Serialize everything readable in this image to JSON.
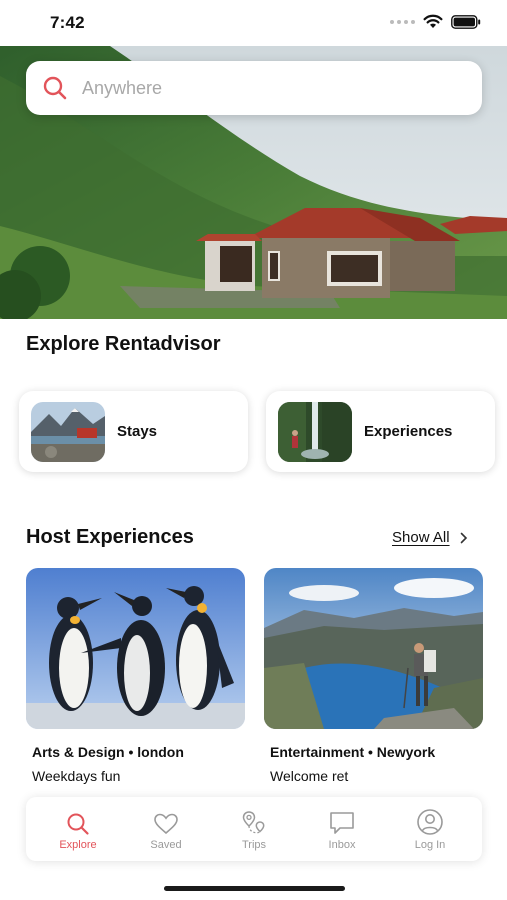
{
  "status_bar": {
    "time": "7:42"
  },
  "search": {
    "placeholder": "Anywhere"
  },
  "explore": {
    "title": "Explore Rentadvisor",
    "categories": [
      {
        "label": "Stays",
        "icon": "mountain-lake-photo"
      },
      {
        "label": "Experiences",
        "icon": "waterfall-hiker-photo"
      }
    ]
  },
  "host_experiences": {
    "title": "Host Experiences",
    "show_all_label": "Show All",
    "items": [
      {
        "title": "Arts & Design • london",
        "subtitle": "Weekdays fun",
        "image": "penguins-photo"
      },
      {
        "title": "Entertainment • Newyork",
        "subtitle": "Welcome ret",
        "image": "fjord-hiker-photo"
      }
    ]
  },
  "tab_bar": {
    "items": [
      {
        "label": "Explore",
        "icon": "search-icon",
        "active": true
      },
      {
        "label": "Saved",
        "icon": "heart-icon"
      },
      {
        "label": "Trips",
        "icon": "map-pin-icon"
      },
      {
        "label": "Inbox",
        "icon": "chat-icon"
      },
      {
        "label": "Log In",
        "icon": "user-circle-icon"
      }
    ]
  },
  "colors": {
    "accent": "#e2545a",
    "inactive": "#9a9a9a",
    "text": "#111111"
  }
}
